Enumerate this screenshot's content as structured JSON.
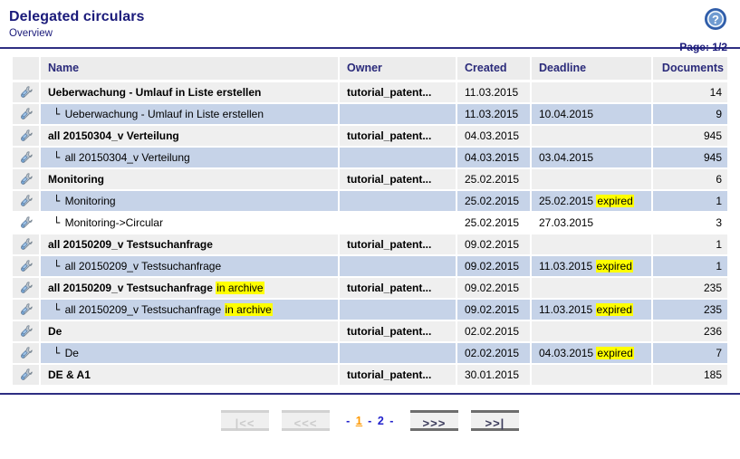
{
  "header": {
    "title": "Delegated circulars",
    "subtitle": "Overview",
    "help_icon": "help-circle-icon",
    "page_indicator": "Page: 1/2"
  },
  "table": {
    "columns": [
      "",
      "Name",
      "Owner",
      "Created",
      "Deadline",
      "Documents"
    ],
    "row_icon": "wrench-icon",
    "tree_glyph": "└",
    "rows": [
      {
        "name": "Ueberwachung - Umlauf in Liste erstellen",
        "badge": "",
        "owner": "tutorial_patent...",
        "created": "11.03.2015",
        "deadline": "",
        "deadline_badge": "",
        "documents": "14",
        "bold": true,
        "child": false,
        "shade": "light"
      },
      {
        "name": "Ueberwachung - Umlauf in Liste erstellen",
        "badge": "",
        "owner": "",
        "created": "11.03.2015",
        "deadline": "10.04.2015",
        "deadline_badge": "",
        "documents": "9",
        "bold": false,
        "child": true,
        "shade": "blue"
      },
      {
        "name": "all 20150304_v Verteilung",
        "badge": "",
        "owner": "tutorial_patent...",
        "created": "04.03.2015",
        "deadline": "",
        "deadline_badge": "",
        "documents": "945",
        "bold": true,
        "child": false,
        "shade": "light"
      },
      {
        "name": "all 20150304_v Verteilung",
        "badge": "",
        "owner": "",
        "created": "04.03.2015",
        "deadline": "03.04.2015",
        "deadline_badge": "",
        "documents": "945",
        "bold": false,
        "child": true,
        "shade": "blue"
      },
      {
        "name": "Monitoring",
        "badge": "",
        "owner": "tutorial_patent...",
        "created": "25.02.2015",
        "deadline": "",
        "deadline_badge": "",
        "documents": "6",
        "bold": true,
        "child": false,
        "shade": "light"
      },
      {
        "name": "Monitoring",
        "badge": "",
        "owner": "",
        "created": "25.02.2015",
        "deadline": "25.02.2015",
        "deadline_badge": "expired",
        "documents": "1",
        "bold": false,
        "child": true,
        "shade": "blue"
      },
      {
        "name": "Monitoring->Circular",
        "badge": "",
        "owner": "",
        "created": "25.02.2015",
        "deadline": "27.03.2015",
        "deadline_badge": "",
        "documents": "3",
        "bold": false,
        "child": true,
        "shade": "none"
      },
      {
        "name": "all 20150209_v Testsuchanfrage",
        "badge": "",
        "owner": "tutorial_patent...",
        "created": "09.02.2015",
        "deadline": "",
        "deadline_badge": "",
        "documents": "1",
        "bold": true,
        "child": false,
        "shade": "light"
      },
      {
        "name": "all 20150209_v Testsuchanfrage",
        "badge": "",
        "owner": "",
        "created": "09.02.2015",
        "deadline": "11.03.2015",
        "deadline_badge": "expired",
        "documents": "1",
        "bold": false,
        "child": true,
        "shade": "blue"
      },
      {
        "name": "all 20150209_v Testsuchanfrage",
        "badge": "in archive",
        "owner": "tutorial_patent...",
        "created": "09.02.2015",
        "deadline": "",
        "deadline_badge": "",
        "documents": "235",
        "bold": true,
        "child": false,
        "shade": "light"
      },
      {
        "name": "all 20150209_v Testsuchanfrage",
        "badge": "in archive",
        "owner": "",
        "created": "09.02.2015",
        "deadline": "11.03.2015",
        "deadline_badge": "expired",
        "documents": "235",
        "bold": false,
        "child": true,
        "shade": "blue"
      },
      {
        "name": "De",
        "badge": "",
        "owner": "tutorial_patent...",
        "created": "02.02.2015",
        "deadline": "",
        "deadline_badge": "",
        "documents": "236",
        "bold": true,
        "child": false,
        "shade": "light"
      },
      {
        "name": "De",
        "badge": "",
        "owner": "",
        "created": "02.02.2015",
        "deadline": "04.03.2015",
        "deadline_badge": "expired",
        "documents": "7",
        "bold": false,
        "child": true,
        "shade": "blue"
      },
      {
        "name": "DE & A1",
        "badge": "",
        "owner": "tutorial_patent...",
        "created": "30.01.2015",
        "deadline": "",
        "deadline_badge": "",
        "documents": "185",
        "bold": true,
        "child": false,
        "shade": "light"
      }
    ]
  },
  "pagination": {
    "first_label": "|<<",
    "prev_label": "<<<",
    "next_label": ">>>",
    "last_label": ">>|",
    "first_disabled": true,
    "prev_disabled": true,
    "separator": "-",
    "pages": [
      {
        "label": "1",
        "current": true
      },
      {
        "label": "2",
        "current": false
      }
    ]
  },
  "colors": {
    "navy": "#2e2e82",
    "header_text": "#2a2a7a",
    "row_light": "#efefef",
    "row_blue": "#c6d3e8",
    "icon_cell": "#ececec",
    "highlight": "#ffff00",
    "current_page": "#ff9900",
    "link": "#2222cc"
  }
}
